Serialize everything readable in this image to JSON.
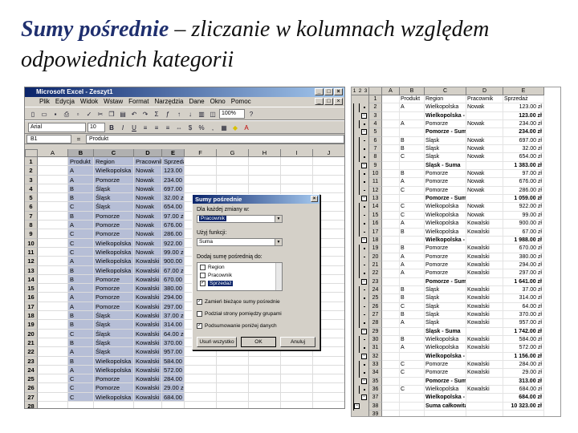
{
  "slide": {
    "title_bold": "Sumy pośrednie",
    "title_rest": " – zliczanie w kolumnach względem odpowiednich kategorii"
  },
  "excel": {
    "window_title": "Microsoft Excel - Zeszyt1",
    "menu": [
      "Plik",
      "Edycja",
      "Widok",
      "Wstaw",
      "Format",
      "Narzędzia",
      "Dane",
      "Okno",
      "Pomoc"
    ],
    "font_name": "Arial",
    "font_size": "10",
    "zoom": "100%",
    "name_box": "B1",
    "formula_fx": "=",
    "formula_value": "Produkt",
    "columns": [
      "A",
      "B",
      "C",
      "D",
      "E",
      "F",
      "G",
      "H",
      "I",
      "J"
    ],
    "rows": [
      [
        "1",
        "Produkt",
        "Region",
        "Pracownik",
        "Sprzedaż"
      ],
      [
        "2",
        "A",
        "Wielkopolska",
        "Nowak",
        "123.00 zł"
      ],
      [
        "3",
        "A",
        "Pomorze",
        "Nowak",
        "234.00 zł"
      ],
      [
        "4",
        "B",
        "Śląsk",
        "Nowak",
        "697.00 zł"
      ],
      [
        "5",
        "B",
        "Śląsk",
        "Nowak",
        "32.00 zł"
      ],
      [
        "6",
        "C",
        "Śląsk",
        "Nowak",
        "654.00 zł"
      ],
      [
        "7",
        "B",
        "Pomorze",
        "Nowak",
        "97.00 zł"
      ],
      [
        "8",
        "A",
        "Pomorze",
        "Nowak",
        "676.00 zł"
      ],
      [
        "9",
        "C",
        "Pomorze",
        "Nowak",
        "286.00 zł"
      ],
      [
        "10",
        "C",
        "Wielkopolska",
        "Nowak",
        "922.00 zł"
      ],
      [
        "11",
        "C",
        "Wielkopolska",
        "Nowak",
        "99.00 zł"
      ],
      [
        "12",
        "A",
        "Wielkopolska",
        "Kowalski",
        "900.00 zł"
      ],
      [
        "13",
        "B",
        "Wielkopolska",
        "Kowalski",
        "67.00 zł"
      ],
      [
        "14",
        "B",
        "Pomorze",
        "Kowalski",
        "670.00 zł"
      ],
      [
        "15",
        "A",
        "Pomorze",
        "Kowalski",
        "380.00 zł"
      ],
      [
        "16",
        "A",
        "Pomorze",
        "Kowalski",
        "294.00 zł"
      ],
      [
        "17",
        "A",
        "Pomorze",
        "Kowalski",
        "297.00 zł"
      ],
      [
        "18",
        "B",
        "Śląsk",
        "Kowalski",
        "37.00 zł"
      ],
      [
        "19",
        "B",
        "Śląsk",
        "Kowalski",
        "314.00 zł"
      ],
      [
        "20",
        "C",
        "Śląsk",
        "Kowalski",
        "64.00 zł"
      ],
      [
        "21",
        "B",
        "Śląsk",
        "Kowalski",
        "370.00 zł"
      ],
      [
        "22",
        "A",
        "Śląsk",
        "Kowalski",
        "957.00 zł"
      ],
      [
        "23",
        "B",
        "Wielkopolska",
        "Kowalski",
        "584.00 zł"
      ],
      [
        "24",
        "A",
        "Wielkopolska",
        "Kowalski",
        "572.00 zł"
      ],
      [
        "25",
        "C",
        "Pomorze",
        "Kowalski",
        "284.00 zł"
      ],
      [
        "26",
        "C",
        "Pomorze",
        "Kowalski",
        "29.00 zł"
      ],
      [
        "27",
        "C",
        "Wielkopolska",
        "Kowalski",
        "684.00 zł"
      ],
      [
        "28",
        "",
        "",
        "",
        ""
      ]
    ]
  },
  "dialog": {
    "title": "Sumy pośrednie",
    "change_label": "Dla każdej zmiany w:",
    "change_value": "Pracownik",
    "function_label": "Użyj funkcji:",
    "function_value": "Suma",
    "add_label": "Dodaj sumę pośrednią do:",
    "fields": [
      {
        "label": "Region",
        "checked": false
      },
      {
        "label": "Pracownik",
        "checked": false
      },
      {
        "label": "Sprzedaż",
        "checked": true
      }
    ],
    "opt_replace": "Zamień bieżące sumy pośrednie",
    "opt_pagebreak": "Podział strony pomiędzy grupami",
    "opt_summary": "Podsumowanie poniżej danych",
    "btn_remove": "Usuń wszystko",
    "btn_ok": "OK",
    "btn_cancel": "Anuluj"
  },
  "result": {
    "levels": [
      "1",
      "2",
      "3"
    ],
    "columns": [
      "A",
      "B",
      "C",
      "D",
      "E"
    ],
    "rows": [
      [
        "1",
        "",
        "Produkt",
        "Region",
        "Pracownik",
        "Sprzedaż",
        ""
      ],
      [
        "2",
        "",
        "A",
        "Wielkopolska",
        "Nowak",
        "123.00 zł",
        ""
      ],
      [
        "3",
        "",
        "",
        "Wielkopolska - Suma",
        "",
        "123.00 zł",
        "b"
      ],
      [
        "4",
        "",
        "A",
        "Pomorze",
        "Nowak",
        "234.00 zł",
        ""
      ],
      [
        "5",
        "",
        "",
        "Pomorze - Suma",
        "",
        "234.00 zł",
        "b"
      ],
      [
        "6",
        "",
        "B",
        "Śląsk",
        "Nowak",
        "697.00 zł",
        ""
      ],
      [
        "7",
        "",
        "B",
        "Śląsk",
        "Nowak",
        "32.00 zł",
        ""
      ],
      [
        "8",
        "",
        "C",
        "Śląsk",
        "Nowak",
        "654.00 zł",
        ""
      ],
      [
        "9",
        "",
        "",
        "Śląsk - Suma",
        "",
        "1 383.00 zł",
        "b"
      ],
      [
        "10",
        "",
        "B",
        "Pomorze",
        "Nowak",
        "97.00 zł",
        ""
      ],
      [
        "11",
        "",
        "A",
        "Pomorze",
        "Nowak",
        "676.00 zł",
        ""
      ],
      [
        "12",
        "",
        "C",
        "Pomorze",
        "Nowak",
        "286.00 zł",
        ""
      ],
      [
        "13",
        "",
        "",
        "Pomorze - Suma",
        "",
        "1 059.00 zł",
        "b"
      ],
      [
        "14",
        "",
        "C",
        "Wielkopolska",
        "Nowak",
        "922.00 zł",
        ""
      ],
      [
        "15",
        "",
        "C",
        "Wielkopolska",
        "Nowak",
        "99.00 zł",
        ""
      ],
      [
        "16",
        "",
        "A",
        "Wielkopolska",
        "Kowalski",
        "900.00 zł",
        ""
      ],
      [
        "17",
        "",
        "B",
        "Wielkopolska",
        "Kowalski",
        "67.00 zł",
        ""
      ],
      [
        "18",
        "",
        "",
        "Wielkopolska - Suma",
        "",
        "1 988.00 zł",
        "b"
      ],
      [
        "19",
        "",
        "B",
        "Pomorze",
        "Kowalski",
        "670.00 zł",
        ""
      ],
      [
        "20",
        "",
        "A",
        "Pomorze",
        "Kowalski",
        "380.00 zł",
        ""
      ],
      [
        "21",
        "",
        "A",
        "Pomorze",
        "Kowalski",
        "294.00 zł",
        ""
      ],
      [
        "22",
        "",
        "A",
        "Pomorze",
        "Kowalski",
        "297.00 zł",
        ""
      ],
      [
        "23",
        "",
        "",
        "Pomorze - Suma",
        "",
        "1 641.00 zł",
        "b"
      ],
      [
        "24",
        "",
        "B",
        "Śląsk",
        "Kowalski",
        "37.00 zł",
        ""
      ],
      [
        "25",
        "",
        "B",
        "Śląsk",
        "Kowalski",
        "314.00 zł",
        ""
      ],
      [
        "26",
        "",
        "C",
        "Śląsk",
        "Kowalski",
        "64.00 zł",
        ""
      ],
      [
        "27",
        "",
        "B",
        "Śląsk",
        "Kowalski",
        "370.00 zł",
        ""
      ],
      [
        "28",
        "",
        "A",
        "Śląsk",
        "Kowalski",
        "957.00 zł",
        ""
      ],
      [
        "29",
        "",
        "",
        "Śląsk - Suma",
        "",
        "1 742.00 zł",
        "b"
      ],
      [
        "30",
        "",
        "B",
        "Wielkopolska",
        "Kowalski",
        "584.00 zł",
        ""
      ],
      [
        "31",
        "",
        "A",
        "Wielkopolska",
        "Kowalski",
        "572.00 zł",
        ""
      ],
      [
        "32",
        "",
        "",
        "Wielkopolska - Suma",
        "",
        "1 156.00 zł",
        "b"
      ],
      [
        "33",
        "",
        "C",
        "Pomorze",
        "Kowalski",
        "284.00 zł",
        ""
      ],
      [
        "34",
        "",
        "C",
        "Pomorze",
        "Kowalski",
        "29.00 zł",
        ""
      ],
      [
        "35",
        "",
        "",
        "Pomorze - Suma",
        "",
        "313.00 zł",
        "b"
      ],
      [
        "36",
        "",
        "C",
        "Wielkopolska",
        "Kowalski",
        "684.00 zł",
        ""
      ],
      [
        "37",
        "",
        "",
        "Wielkopolska - Suma",
        "",
        "684.00 zł",
        "b"
      ],
      [
        "38",
        "",
        "",
        "Suma całkowita",
        "",
        "10 323.00 zł",
        "b"
      ],
      [
        "39",
        "",
        "",
        "",
        "",
        "",
        ""
      ]
    ]
  }
}
